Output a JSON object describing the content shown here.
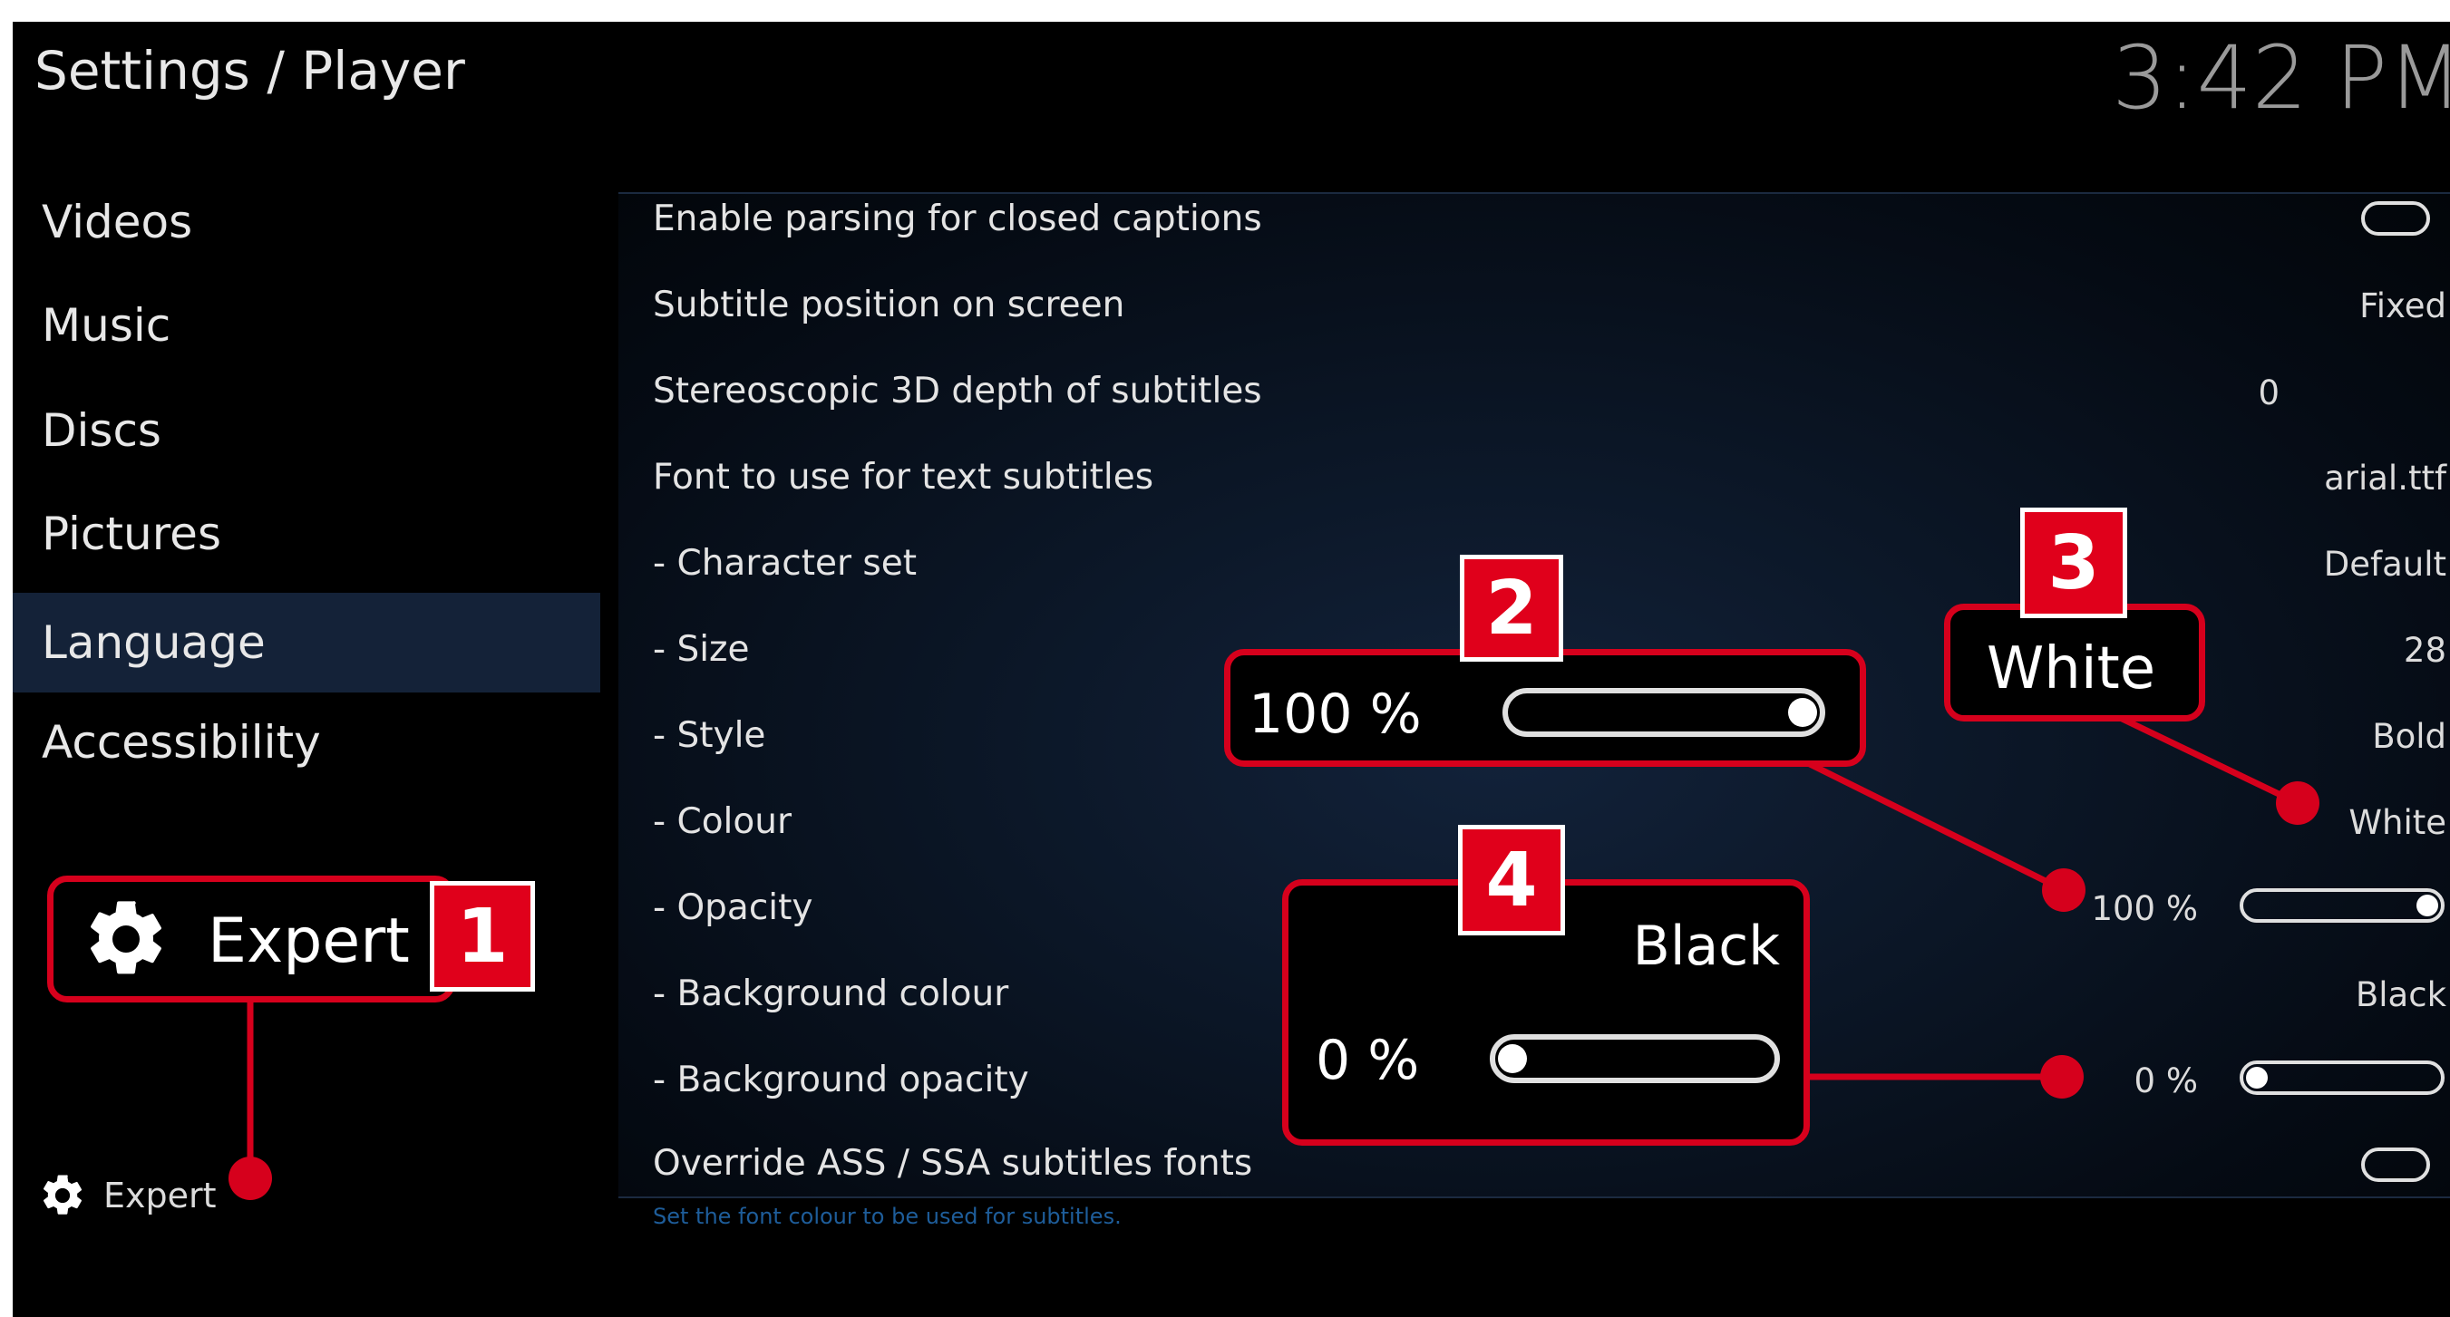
{
  "header": {
    "breadcrumb": "Settings / Player",
    "clock": "3:42 PM"
  },
  "sidebar": {
    "items": [
      {
        "label": "Videos"
      },
      {
        "label": "Music"
      },
      {
        "label": "Discs"
      },
      {
        "label": "Pictures"
      },
      {
        "label": "Language",
        "active": true
      },
      {
        "label": "Accessibility"
      }
    ],
    "level_label": "Expert"
  },
  "settings": [
    {
      "label": "Enable parsing for closed captions",
      "control": "toggle",
      "state": "off"
    },
    {
      "label": "Subtitle position on screen",
      "value": "Fixed"
    },
    {
      "label": "Stereoscopic 3D depth of subtitles",
      "value": "0"
    },
    {
      "label": "Font to use for text subtitles",
      "value": "arial.ttf"
    },
    {
      "label": "- Character set",
      "value": "Default"
    },
    {
      "label": "- Size",
      "value": "28"
    },
    {
      "label": "- Style",
      "value": "Bold"
    },
    {
      "label": "- Colour",
      "value": "White"
    },
    {
      "label": "- Opacity",
      "value": "100 %",
      "slider_level": 1.0
    },
    {
      "label": "- Background colour",
      "value": "Black"
    },
    {
      "label": "- Background opacity",
      "value": "0 %",
      "slider_level": 0.0
    },
    {
      "label": "Override ASS / SSA subtitles fonts",
      "control": "toggle",
      "state": "off"
    }
  ],
  "help_text": "Set the font colour to be used for subtitles.",
  "callouts": {
    "c1": {
      "number": "1",
      "label": "Expert"
    },
    "c2": {
      "number": "2",
      "value": "100 %",
      "slider_level": 1.0
    },
    "c3": {
      "number": "3",
      "value": "White"
    },
    "c4": {
      "number": "4",
      "colour": "Black",
      "value": "0 %",
      "slider_level": 0.0
    }
  },
  "colors": {
    "background": "#000000",
    "active_nav": "#142238",
    "callout_red": "#d6001c",
    "help_text": "#1e5d9a"
  },
  "icons": [
    "gear-icon"
  ]
}
